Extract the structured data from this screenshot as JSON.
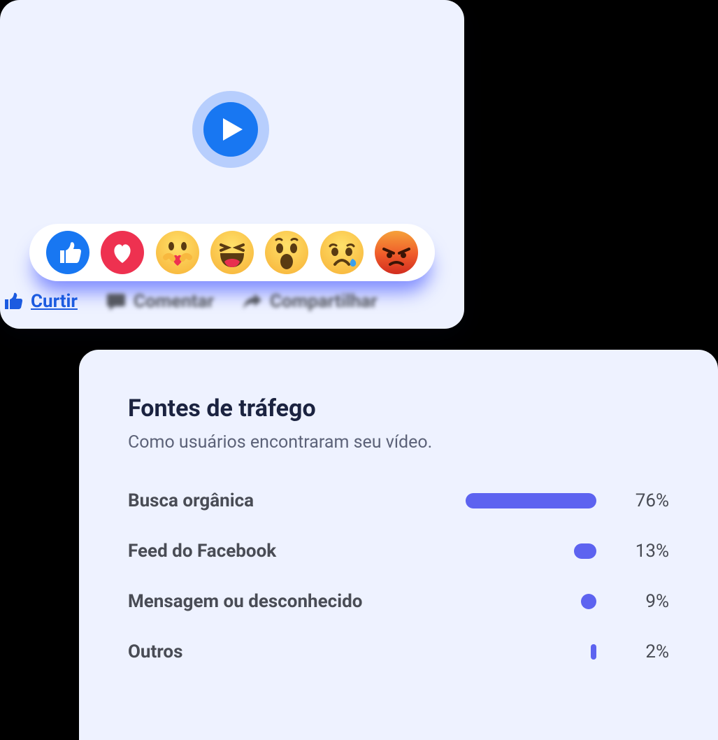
{
  "video_card": {
    "reactions": [
      "like",
      "love",
      "care",
      "haha",
      "wow",
      "sad",
      "angry"
    ]
  },
  "actions": {
    "like": {
      "label": "Curtir",
      "icon": "thumb-up-icon"
    },
    "comment": {
      "label": "Comentar",
      "icon": "comment-icon"
    },
    "share": {
      "label": "Compartilhar",
      "icon": "share-icon"
    }
  },
  "traffic": {
    "title": "Fontes de tráfego",
    "subtitle": "Como usuários encontraram seu vídeo.",
    "rows": [
      {
        "label": "Busca orgânica",
        "pct": 76
      },
      {
        "label": "Feed do Facebook",
        "pct": 13
      },
      {
        "label": "Mensagem ou desconhecido",
        "pct": 9
      },
      {
        "label": "Outros",
        "pct": 2
      }
    ]
  },
  "chart_data": {
    "type": "bar",
    "title": "Fontes de tráfego",
    "subtitle": "Como usuários encontraram seu vídeo.",
    "categories": [
      "Busca orgânica",
      "Feed do Facebook",
      "Mensagem ou desconhecido",
      "Outros"
    ],
    "values": [
      76,
      13,
      9,
      2
    ],
    "xlabel": "",
    "ylabel": "%",
    "ylim": [
      0,
      100
    ]
  },
  "colors": {
    "accent": "#5d63f0",
    "fb_blue": "#1877f2",
    "link_blue": "#1c5be0"
  }
}
